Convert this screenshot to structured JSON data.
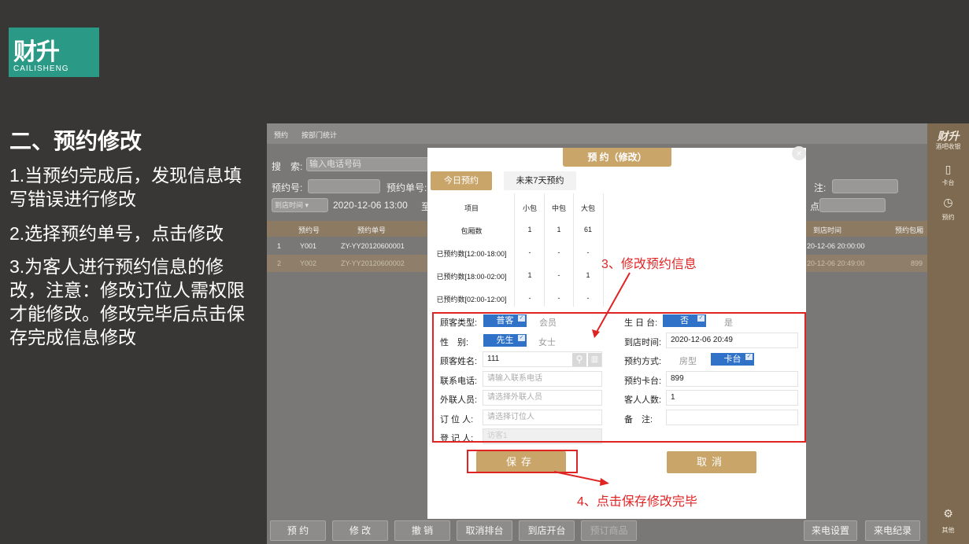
{
  "logo": {
    "main": "财升",
    "sub": "CAILISHENG"
  },
  "slide": {
    "title": "二、预约修改",
    "steps": [
      "1.当预约完成后，发现信息填写错误进行修改",
      "2.选择预约单号，点击修改",
      "3.为客人进行预约信息的修改，注意：修改订位人需权限才能修改。修改完毕后点击保存完成信息修改"
    ]
  },
  "app": {
    "tabs": [
      "预约",
      "按部门统计"
    ],
    "search_label": "搜　索:",
    "search_placeholder": "输入电话号码",
    "order_no_label": "预约号:",
    "booking_no_label": "预约单号:",
    "note_label": "注:",
    "time_filter": "到店时间",
    "time_value": "2020-12-06 13:00",
    "to_label": "至",
    "right_label": "点:",
    "table": {
      "headers": [
        "预约号",
        "预约单号",
        "到店时间",
        "预约包厢"
      ],
      "rows": [
        {
          "idx": "1",
          "no": "Y001",
          "order": "ZY-YY20120600001",
          "time": "20-12-06 20:00:00",
          "room": ""
        },
        {
          "idx": "2",
          "no": "Y002",
          "order": "ZY-YY20120600002",
          "time": "20-12-06 20:49:00",
          "room": "899"
        }
      ]
    },
    "bottom_buttons": [
      "预 约",
      "修 改",
      "撤 销",
      "取消排台",
      "到店开台",
      "预订商品",
      "来电设置",
      "来电纪录"
    ]
  },
  "sidebar": {
    "brand": "财升",
    "brand_sub": "酒吧收银",
    "items": [
      {
        "label": "卡台"
      },
      {
        "label": "预约"
      },
      {
        "label": "其他"
      }
    ]
  },
  "modal": {
    "title": "预 约（修改）",
    "close": "×",
    "tabs": [
      "今日预约",
      "未来7天预约"
    ],
    "stats": {
      "headers": [
        "项目",
        "小包",
        "中包",
        "大包"
      ],
      "rows": [
        {
          "label": "包厢数",
          "s": "1",
          "m": "1",
          "l": "61"
        },
        {
          "label": "已预约数[12:00-18:00]",
          "s": "-",
          "m": "-",
          "l": "-"
        },
        {
          "label": "已预约数[18:00-02:00]",
          "s": "1",
          "m": "-",
          "l": "1"
        },
        {
          "label": "已预约数[02:00-12:00]",
          "s": "-",
          "m": "-",
          "l": "-"
        }
      ]
    },
    "form": {
      "customer_type_label": "顾客类型:",
      "customer_type_on": "普客",
      "customer_type_off": "会员",
      "gender_label": "性　别:",
      "gender_on": "先生",
      "gender_off": "女士",
      "name_label": "顾客姓名:",
      "name_value": "111",
      "phone_label": "联系电话:",
      "phone_placeholder": "请输入联系电话",
      "contact_label": "外联人员:",
      "contact_placeholder": "请选择外联人员",
      "booker_label": "订 位 人:",
      "booker_placeholder": "请选择订位人",
      "register_label": "登 记 人:",
      "register_value": "访客1",
      "birthday_label": "生 日 台:",
      "birthday_on": "否",
      "birthday_off": "是",
      "arrive_label": "到店时间:",
      "arrive_value": "2020-12-06 20:49",
      "method_label": "预约方式:",
      "method_off": "房型",
      "method_on": "卡台",
      "card_label": "预约卡台:",
      "card_value": "899",
      "guests_label": "客人人数:",
      "guests_value": "1",
      "remark_label": "备　注:",
      "remark_value": ""
    },
    "save": "保存",
    "cancel": "取消"
  },
  "annotations": {
    "a3": "3、修改预约信息",
    "a4": "4、点击保存修改完毕"
  },
  "colors": {
    "accent": "#c9a56a",
    "select_blue": "#2f72c8",
    "annotation_red": "#e02424",
    "logo_green": "#2a9a86"
  }
}
